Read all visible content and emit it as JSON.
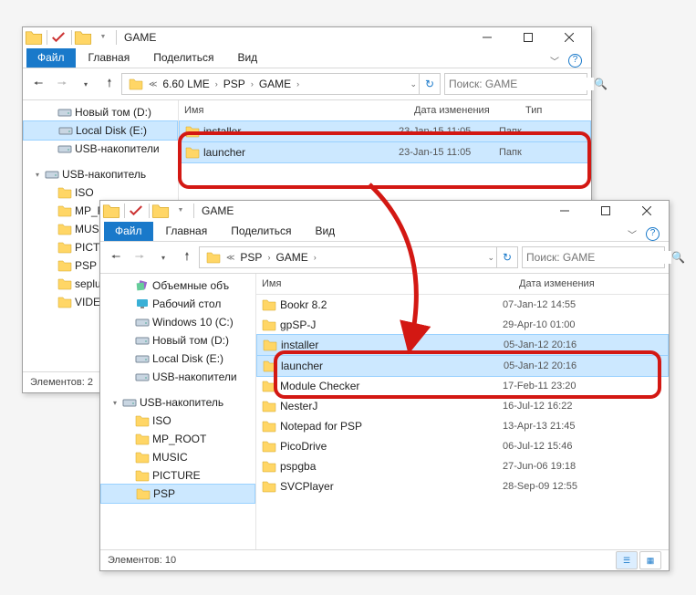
{
  "w1": {
    "title": "GAME",
    "tabs": {
      "file": "Файл",
      "home": "Главная",
      "share": "Поделиться",
      "view": "Вид"
    },
    "breadcrumb": [
      "6.60 LME",
      "PSP",
      "GAME"
    ],
    "search_placeholder": "Поиск: GAME",
    "columns": {
      "name": "Имя",
      "date": "Дата изменения",
      "type": "Тип"
    },
    "tree": [
      {
        "label": "Новый том (D:)",
        "icon": "drive",
        "indent": 28
      },
      {
        "label": "Local Disk (E:)",
        "icon": "drive",
        "indent": 28,
        "sel": true
      },
      {
        "label": "USB-накопители",
        "icon": "drive",
        "indent": 28
      },
      {
        "label": "",
        "spacer": true
      },
      {
        "label": "USB-накопитель",
        "icon": "drive",
        "indent": 14,
        "exp": true
      },
      {
        "label": "ISO",
        "icon": "folder",
        "indent": 28
      },
      {
        "label": "MP_ROOT",
        "icon": "folder",
        "indent": 28
      },
      {
        "label": "MUSIC",
        "icon": "folder",
        "indent": 28
      },
      {
        "label": "PICTURE",
        "icon": "folder",
        "indent": 28
      },
      {
        "label": "PSP",
        "icon": "folder",
        "indent": 28
      },
      {
        "label": "seplugins",
        "icon": "folder",
        "indent": 28
      },
      {
        "label": "VIDEO",
        "icon": "folder",
        "indent": 28
      }
    ],
    "rows": [
      {
        "name": "installer",
        "date": "23-Jan-15 11:05",
        "type": "Папк",
        "sel": true
      },
      {
        "name": "launcher",
        "date": "23-Jan-15 11:05",
        "type": "Папк",
        "sel": true
      }
    ],
    "status": "Элементов: 2"
  },
  "w2": {
    "title": "GAME",
    "tabs": {
      "file": "Файл",
      "home": "Главная",
      "share": "Поделиться",
      "view": "Вид"
    },
    "breadcrumb": [
      "PSP",
      "GAME"
    ],
    "search_placeholder": "Поиск: GAME",
    "columns": {
      "name": "Имя",
      "date": "Дата изменения"
    },
    "tree": [
      {
        "label": "Объемные объ",
        "icon": "obj",
        "indent": 28
      },
      {
        "label": "Рабочий стол",
        "icon": "desk",
        "indent": 28
      },
      {
        "label": "Windows 10 (C:)",
        "icon": "drive",
        "indent": 28
      },
      {
        "label": "Новый том (D:)",
        "icon": "drive",
        "indent": 28
      },
      {
        "label": "Local Disk (E:)",
        "icon": "drive",
        "indent": 28
      },
      {
        "label": "USB-накопители",
        "icon": "drive",
        "indent": 28
      },
      {
        "label": "",
        "spacer": true
      },
      {
        "label": "USB-накопитель",
        "icon": "drive",
        "indent": 14,
        "exp": true
      },
      {
        "label": "ISO",
        "icon": "folder",
        "indent": 28
      },
      {
        "label": "MP_ROOT",
        "icon": "folder",
        "indent": 28
      },
      {
        "label": "MUSIC",
        "icon": "folder",
        "indent": 28
      },
      {
        "label": "PICTURE",
        "icon": "folder",
        "indent": 28
      },
      {
        "label": "PSP",
        "icon": "folder",
        "indent": 28,
        "sel": true
      }
    ],
    "rows": [
      {
        "name": "Bookr 8.2",
        "date": "07-Jan-12 14:55"
      },
      {
        "name": "gpSP-J",
        "date": "29-Apr-10 01:00"
      },
      {
        "name": "installer",
        "date": "05-Jan-12 20:16",
        "sel": true
      },
      {
        "name": "launcher",
        "date": "05-Jan-12 20:16",
        "sel": true
      },
      {
        "name": "Module Checker",
        "date": "17-Feb-11 23:20"
      },
      {
        "name": "NesterJ",
        "date": "16-Jul-12 16:22"
      },
      {
        "name": "Notepad for PSP",
        "date": "13-Apr-13 21:45"
      },
      {
        "name": "PicoDrive",
        "date": "06-Jul-12 15:46"
      },
      {
        "name": "pspgba",
        "date": "27-Jun-06 19:18"
      },
      {
        "name": "SVCPlayer",
        "date": "28-Sep-09 12:55"
      }
    ],
    "status": "Элементов: 10"
  }
}
